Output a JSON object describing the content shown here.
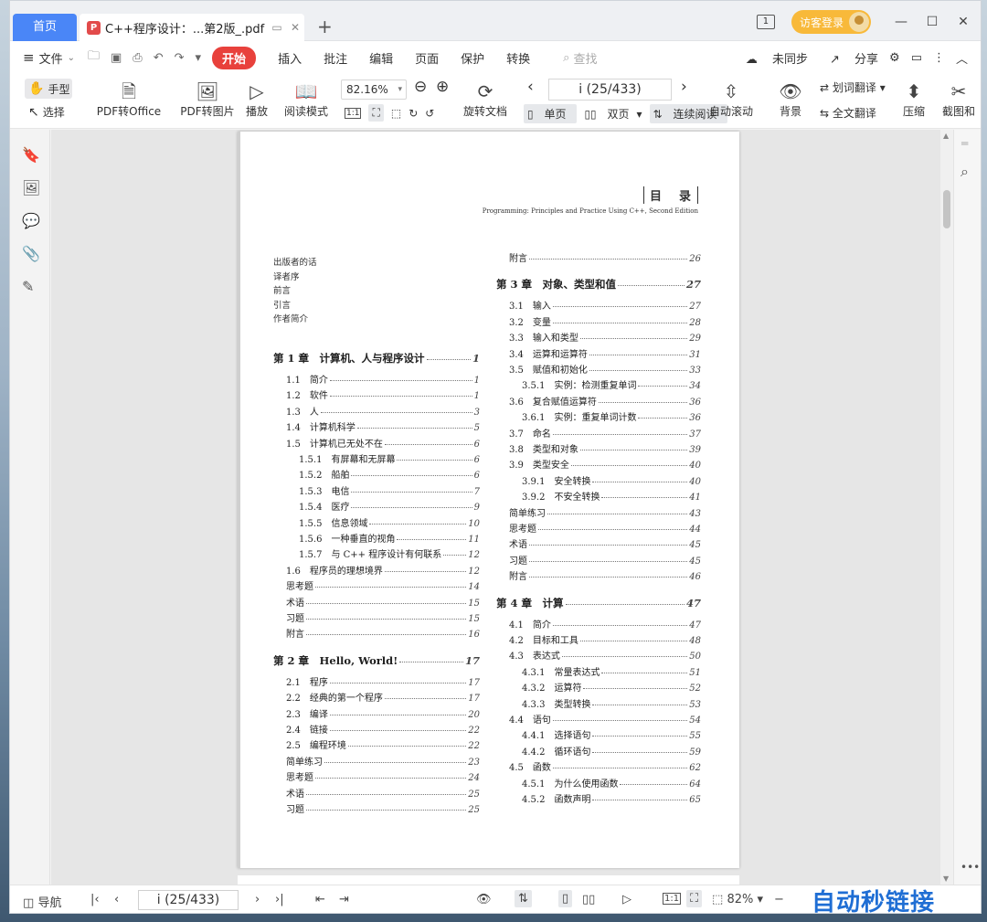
{
  "window": {
    "home_tab": "首页",
    "doc_tab": "C++程序设计：...第2版_.pdf",
    "login_label": "访客登录",
    "window_counter": "1"
  },
  "menu": {
    "file": "文件",
    "start": "开始",
    "tabs": [
      "插入",
      "批注",
      "编辑",
      "页面",
      "保护",
      "转换"
    ],
    "search_placeholder": "查找",
    "sync": "未同步",
    "share": "分享"
  },
  "toolbar": {
    "hand": "手型",
    "select": "选择",
    "pdf_to_office": "PDF转Office",
    "pdf_to_image": "PDF转图片",
    "play": "播放",
    "read_mode": "阅读模式",
    "zoom": "82.16%",
    "page_indicator": "i (25/433)",
    "rotate": "旋转文档",
    "single": "单页",
    "double": "双页",
    "continuous": "连续阅读",
    "auto_scroll": "自动滚动",
    "background": "背景",
    "word_translate": "划词翻译",
    "full_translate": "全文翻译",
    "compress": "压缩",
    "screenshot": "截图和"
  },
  "status": {
    "nav": "导航",
    "page": "i (25/433)",
    "zoom": "82%"
  },
  "watermark": "自动秒链接",
  "document": {
    "header_title": "目　录",
    "header_subtitle": "Programming: Principles and Practice Using C++, Second Edition",
    "front_matter": [
      "出版者的话",
      "译者序",
      "前言",
      "引言",
      "作者简介"
    ],
    "left_col": [
      {
        "type": "ch",
        "label": "第 1 章　计算机、人与程序设计",
        "page": "1"
      },
      {
        "type": "sec",
        "label": "1.1　简介",
        "page": "1"
      },
      {
        "type": "sec",
        "label": "1.2　软件",
        "page": "1"
      },
      {
        "type": "sec",
        "label": "1.3　人",
        "page": "3"
      },
      {
        "type": "sec",
        "label": "1.4　计算机科学",
        "page": "5"
      },
      {
        "type": "sec",
        "label": "1.5　计算机已无处不在",
        "page": "6"
      },
      {
        "type": "sub",
        "label": "1.5.1　有屏幕和无屏幕",
        "page": "6"
      },
      {
        "type": "sub",
        "label": "1.5.2　船舶",
        "page": "6"
      },
      {
        "type": "sub",
        "label": "1.5.3　电信",
        "page": "7"
      },
      {
        "type": "sub",
        "label": "1.5.4　医疗",
        "page": "9"
      },
      {
        "type": "sub",
        "label": "1.5.5　信息领域",
        "page": "10"
      },
      {
        "type": "sub",
        "label": "1.5.6　一种垂直的视角",
        "page": "11"
      },
      {
        "type": "sub",
        "label": "1.5.7　与 C++ 程序设计有何联系",
        "page": "12"
      },
      {
        "type": "sec",
        "label": "1.6　程序员的理想境界",
        "page": "12"
      },
      {
        "type": "top",
        "label": "思考题",
        "page": "14"
      },
      {
        "type": "top",
        "label": "术语",
        "page": "15"
      },
      {
        "type": "top",
        "label": "习题",
        "page": "15"
      },
      {
        "type": "top",
        "label": "附言",
        "page": "16"
      },
      {
        "type": "ch",
        "label": "第 2 章　Hello, World!",
        "page": "17"
      },
      {
        "type": "sec",
        "label": "2.1　程序",
        "page": "17"
      },
      {
        "type": "sec",
        "label": "2.2　经典的第一个程序",
        "page": "17"
      },
      {
        "type": "sec",
        "label": "2.3　编译",
        "page": "20"
      },
      {
        "type": "sec",
        "label": "2.4　链接",
        "page": "22"
      },
      {
        "type": "sec",
        "label": "2.5　编程环境",
        "page": "22"
      },
      {
        "type": "top",
        "label": "简单练习",
        "page": "23"
      },
      {
        "type": "top",
        "label": "思考题",
        "page": "24"
      },
      {
        "type": "top",
        "label": "术语",
        "page": "25"
      },
      {
        "type": "top",
        "label": "习题",
        "page": "25"
      }
    ],
    "right_col": [
      {
        "type": "top",
        "label": "附言",
        "page": "26"
      },
      {
        "type": "ch",
        "label": "第 3 章　对象、类型和值",
        "page": "27"
      },
      {
        "type": "sec",
        "label": "3.1　输入",
        "page": "27"
      },
      {
        "type": "sec",
        "label": "3.2　变量",
        "page": "28"
      },
      {
        "type": "sec",
        "label": "3.3　输入和类型",
        "page": "29"
      },
      {
        "type": "sec",
        "label": "3.4　运算和运算符",
        "page": "31"
      },
      {
        "type": "sec",
        "label": "3.5　赋值和初始化",
        "page": "33"
      },
      {
        "type": "sub",
        "label": "3.5.1　实例：检测重复单词",
        "page": "34"
      },
      {
        "type": "sec",
        "label": "3.6　复合赋值运算符",
        "page": "36"
      },
      {
        "type": "sub",
        "label": "3.6.1　实例：重复单词计数",
        "page": "36"
      },
      {
        "type": "sec",
        "label": "3.7　命名",
        "page": "37"
      },
      {
        "type": "sec",
        "label": "3.8　类型和对象",
        "page": "39"
      },
      {
        "type": "sec",
        "label": "3.9　类型安全",
        "page": "40"
      },
      {
        "type": "sub",
        "label": "3.9.1　安全转换",
        "page": "40"
      },
      {
        "type": "sub",
        "label": "3.9.2　不安全转换",
        "page": "41"
      },
      {
        "type": "top",
        "label": "简单练习",
        "page": "43"
      },
      {
        "type": "top",
        "label": "思考题",
        "page": "44"
      },
      {
        "type": "top",
        "label": "术语",
        "page": "45"
      },
      {
        "type": "top",
        "label": "习题",
        "page": "45"
      },
      {
        "type": "top",
        "label": "附言",
        "page": "46"
      },
      {
        "type": "ch",
        "label": "第 4 章　计算",
        "page": "47"
      },
      {
        "type": "sec",
        "label": "4.1　简介",
        "page": "47"
      },
      {
        "type": "sec",
        "label": "4.2　目标和工具",
        "page": "48"
      },
      {
        "type": "sec",
        "label": "4.3　表达式",
        "page": "50"
      },
      {
        "type": "sub",
        "label": "4.3.1　常量表达式",
        "page": "51"
      },
      {
        "type": "sub",
        "label": "4.3.2　运算符",
        "page": "52"
      },
      {
        "type": "sub",
        "label": "4.3.3　类型转换",
        "page": "53"
      },
      {
        "type": "sec",
        "label": "4.4　语句",
        "page": "54"
      },
      {
        "type": "sub",
        "label": "4.4.1　选择语句",
        "page": "55"
      },
      {
        "type": "sub",
        "label": "4.4.2　循环语句",
        "page": "59"
      },
      {
        "type": "sec",
        "label": "4.5　函数",
        "page": "62"
      },
      {
        "type": "sub",
        "label": "4.5.1　为什么使用函数",
        "page": "64"
      },
      {
        "type": "sub",
        "label": "4.5.2　函数声明",
        "page": "65"
      }
    ]
  }
}
